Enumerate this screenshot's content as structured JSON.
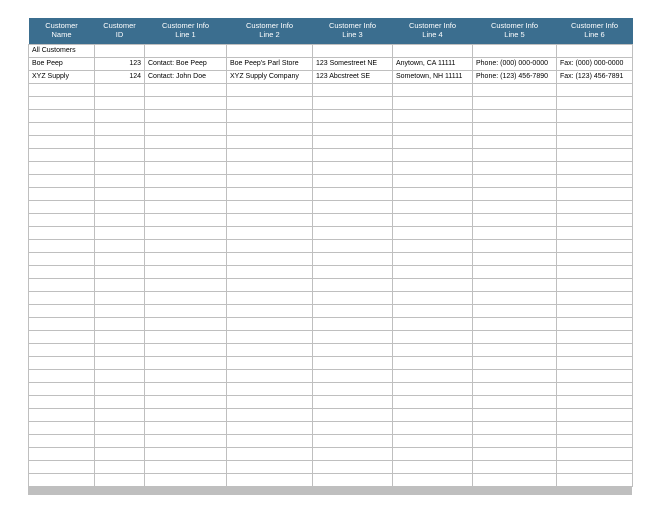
{
  "headers": [
    "Customer\nName",
    "Customer\nID",
    "Customer Info\nLine 1",
    "Customer Info\nLine 2",
    "Customer Info\nLine 3",
    "Customer Info\nLine 4",
    "Customer Info\nLine 5",
    "Customer Info\nLine 6"
  ],
  "rows": [
    {
      "name": "All Customers",
      "id": "",
      "c1": "",
      "c2": "",
      "c3": "",
      "c4": "",
      "c5": "",
      "c6": ""
    },
    {
      "name": "Boe Peep",
      "id": "123",
      "c1": "Contact: Boe Peep",
      "c2": "Boe Peep's Parl Store",
      "c3": "123 Somestreet NE",
      "c4": "Anytown, CA 11111",
      "c5": "Phone: (000) 000-0000",
      "c6": "Fax: (000) 000-0000"
    },
    {
      "name": "XYZ Supply",
      "id": "124",
      "c1": "Contact: John Doe",
      "c2": "XYZ Supply Company",
      "c3": "123 Abcstreet SE",
      "c4": "Sometown, NH 11111",
      "c5": "Phone: (123) 456-7890",
      "c6": "Fax: (123) 456-7891"
    }
  ],
  "empty_row_count": 31
}
